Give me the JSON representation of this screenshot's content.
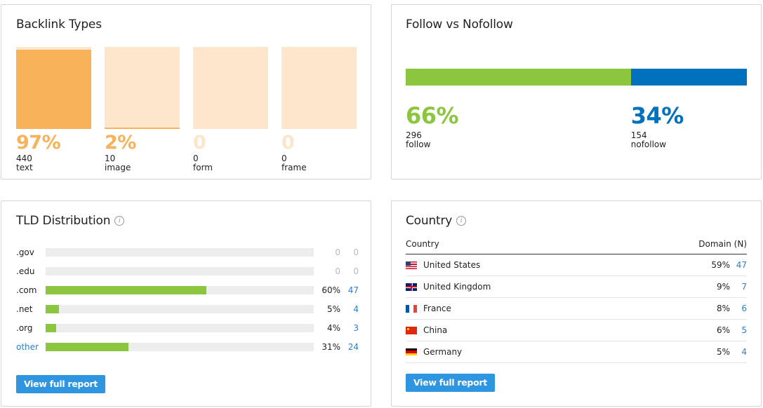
{
  "colors": {
    "orange": "#f8b35a",
    "orange_light": "#fde6cc",
    "green": "#8cc63f",
    "blue_dark": "#0071bc",
    "link_blue": "#2e7fd3",
    "button_blue": "#2e95e0"
  },
  "backlink_types": {
    "title": "Backlink Types",
    "items": [
      {
        "pct_label": "97%",
        "fraction": 0.97,
        "count": "440",
        "label": "text"
      },
      {
        "pct_label": "2%",
        "fraction": 0.02,
        "count": "10",
        "label": "image"
      },
      {
        "pct_label": "0",
        "fraction": 0,
        "count": "0",
        "label": "form"
      },
      {
        "pct_label": "0",
        "fraction": 0,
        "count": "0",
        "label": "frame"
      }
    ]
  },
  "follow_nofollow": {
    "title": "Follow vs Nofollow",
    "follow": {
      "pct_label": "66%",
      "fraction": 0.66,
      "count": "296",
      "label": "follow"
    },
    "nofollow": {
      "pct_label": "34%",
      "fraction": 0.34,
      "count": "154",
      "label": "nofollow"
    }
  },
  "tld_distribution": {
    "title": "TLD Distribution",
    "info_icon": "info-icon",
    "rows": [
      {
        "tld": ".gov",
        "fraction": 0,
        "pct": "0",
        "count": "0",
        "is_link": false,
        "muted": true
      },
      {
        "tld": ".edu",
        "fraction": 0,
        "pct": "0",
        "count": "0",
        "is_link": false,
        "muted": true
      },
      {
        "tld": ".com",
        "fraction": 0.6,
        "pct": "60%",
        "count": "47",
        "is_link": false,
        "muted": false
      },
      {
        "tld": ".net",
        "fraction": 0.05,
        "pct": "5%",
        "count": "4",
        "is_link": false,
        "muted": false
      },
      {
        "tld": ".org",
        "fraction": 0.04,
        "pct": "4%",
        "count": "3",
        "is_link": false,
        "muted": false
      },
      {
        "tld": "other",
        "fraction": 0.31,
        "pct": "31%",
        "count": "24",
        "is_link": true,
        "muted": false
      }
    ],
    "button_label": "View full report"
  },
  "country": {
    "title": "Country",
    "info_icon": "info-icon",
    "col_country": "Country",
    "col_domain": "Domain (N)",
    "rows": [
      {
        "flag": "us",
        "name": "United States",
        "pct": "59%",
        "count": "47"
      },
      {
        "flag": "gb",
        "name": "United Kingdom",
        "pct": "9%",
        "count": "7"
      },
      {
        "flag": "fr",
        "name": "France",
        "pct": "8%",
        "count": "6"
      },
      {
        "flag": "cn",
        "name": "China",
        "pct": "6%",
        "count": "5"
      },
      {
        "flag": "de",
        "name": "Germany",
        "pct": "5%",
        "count": "4"
      }
    ],
    "button_label": "View full report"
  }
}
